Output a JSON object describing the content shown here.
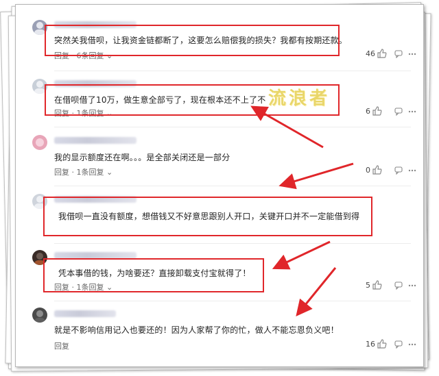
{
  "comments": [
    {
      "text": "突然关我借呗，让我资金链都断了，这要怎么赔偿我的损失？我都有按期还款。",
      "reply_label": "回复",
      "replies_label": "6条回复",
      "likes": "46",
      "avatar_color": "#9aa0b5"
    },
    {
      "text": "在借呗借了10万，做生意全部亏了，现在根本还不上了不",
      "reply_label": "回复",
      "replies_label": "1条回复",
      "likes": "6",
      "avatar_color": "#c8cfd8"
    },
    {
      "text": "我的显示额度还在啊。。。是全部关闭还是一部分",
      "reply_label": "回复",
      "replies_label": "1条回复",
      "likes": "0",
      "avatar_color": "#e8a5b8"
    },
    {
      "text": "我借呗一直没有额度，想借钱又不好意思跟别人开口，关键开口并不一定能借到得",
      "reply_label": "",
      "replies_label": "",
      "likes": "",
      "avatar_color": "#cfd4dc"
    },
    {
      "text": "凭本事借的钱，为啥要还？直接卸载支付宝就得了！",
      "reply_label": "回复",
      "replies_label": "1条回复",
      "likes": "5",
      "avatar_color": "#3a2c28"
    },
    {
      "text": "就是不影响信用记入也要还的！因为人家帮了你的忙，做人不能忘恩负义吧！",
      "reply_label": "回复",
      "replies_label": "",
      "likes": "16",
      "avatar_color": "#4a4a4a"
    }
  ],
  "watermark": "流浪者",
  "separator": "·",
  "colors": {
    "highlight_red": "#e0262a",
    "watermark": "#e9d66a"
  },
  "icons": [
    "thumb-up-icon",
    "reply-bubble-icon",
    "more-dots-icon",
    "chevron-down-icon",
    "red-arrow"
  ]
}
